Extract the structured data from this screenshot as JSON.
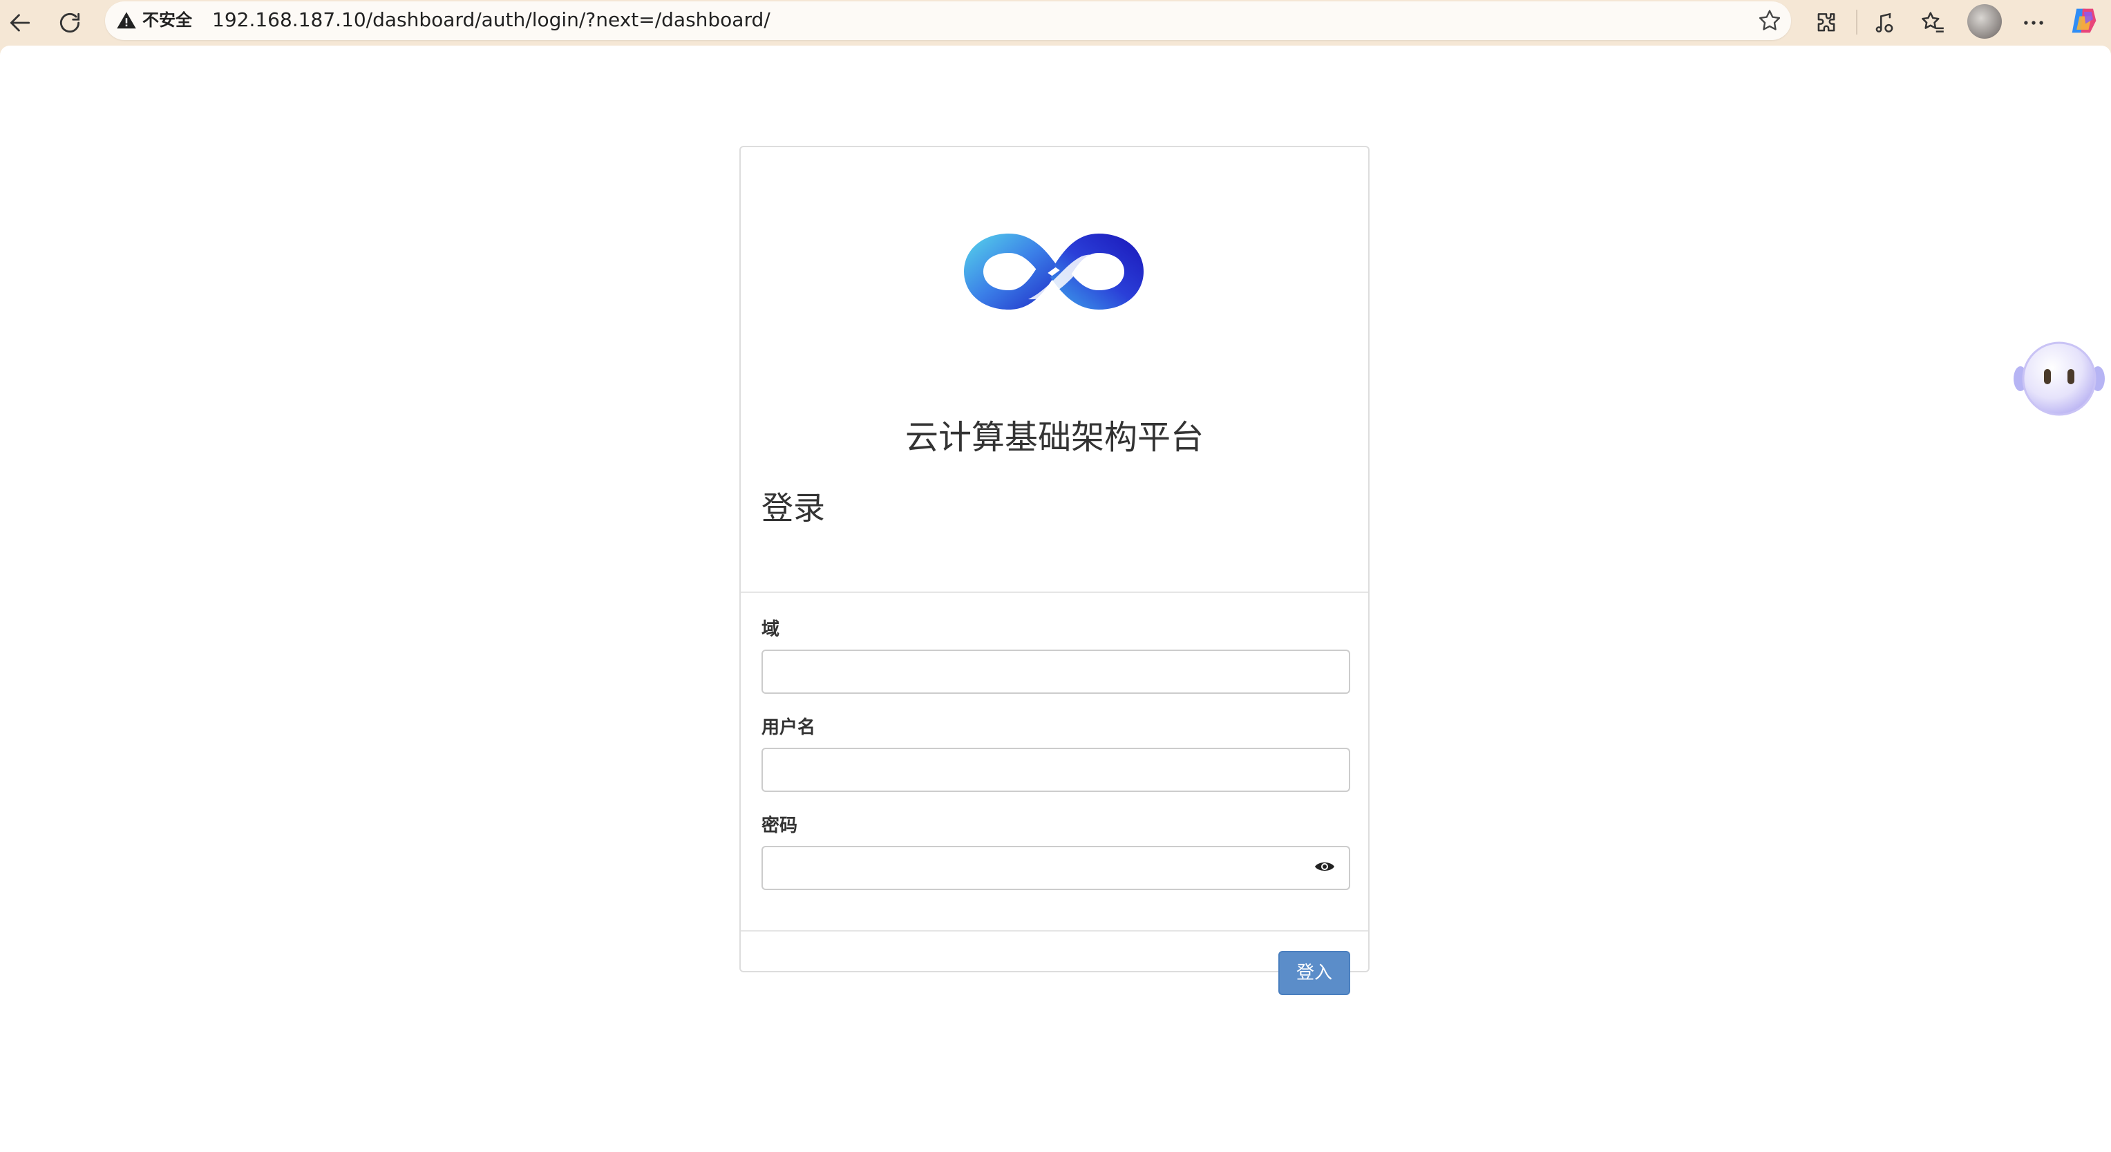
{
  "browser": {
    "security_label": "不安全",
    "url": "192.168.187.10/dashboard/auth/login/?next=/dashboard/",
    "icons": [
      "back-icon",
      "refresh-icon",
      "warning-icon",
      "favorite-star-icon",
      "extensions-icon",
      "media-icon",
      "favorites-icon",
      "profile-avatar",
      "more-icon",
      "copilot-icon"
    ]
  },
  "login": {
    "platform_title": "云计算基础架构平台",
    "heading": "登录",
    "fields": [
      {
        "label": "域",
        "value": ""
      },
      {
        "label": "用户名",
        "value": ""
      },
      {
        "label": "密码",
        "value": ""
      }
    ],
    "submit_label": "登入"
  },
  "colors": {
    "chrome_bg": "#f5e7d5",
    "button_bg": "#5b8dc9",
    "logo_gradient": [
      "#4fd1e8",
      "#3a5ce0",
      "#1d1fbf"
    ]
  }
}
